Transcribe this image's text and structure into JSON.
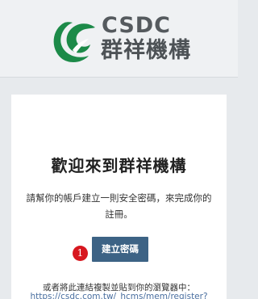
{
  "header": {
    "logo_latin": "CSDC",
    "logo_cjk": "群祥機構",
    "brand_green": "#1c8a48",
    "logo_icon": "leaf-swirl-logo-icon"
  },
  "email": {
    "heading": "歡迎來到群祥機構",
    "instruction": "請幫你的帳戶建立一則安全密碼，來完成你的註冊。",
    "create_password_button": "建立密碼",
    "copy_note": "或者將此連結複製並貼到你的瀏覽器中：",
    "register_link": "https://csdc.com.tw/_hcms/mem/register?"
  },
  "annotation": {
    "step_marker": "1",
    "marker_color": "#d7171f"
  },
  "colors": {
    "button_bg": "#3d6385",
    "page_bg": "#e7eaed",
    "link": "#4a6fa0"
  }
}
